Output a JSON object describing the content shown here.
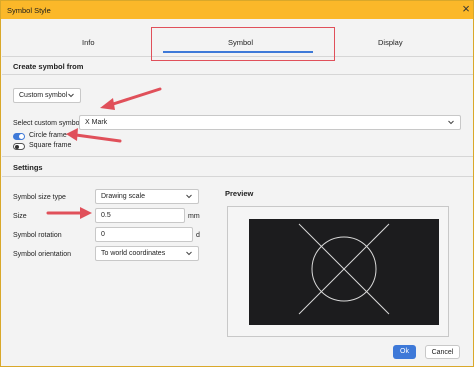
{
  "window": {
    "title": "Symbol Style",
    "close_glyph": "×"
  },
  "tabs": [
    {
      "label": "Info"
    },
    {
      "label": "Symbol"
    },
    {
      "label": "Display"
    }
  ],
  "create_section": {
    "heading": "Create symbol from",
    "source_select": {
      "value": "Custom symbol",
      "icon": "chevron-down-icon"
    },
    "custom_symbol_label": "Select custom symbol",
    "custom_symbol_select": {
      "value": "X Mark",
      "icon": "chevron-down-icon"
    },
    "circle_frame": {
      "label": "Circle frame",
      "state": "on"
    },
    "square_frame": {
      "label": "Square frame",
      "state": "off"
    }
  },
  "settings_section": {
    "heading": "Settings",
    "size_type": {
      "label": "Symbol size type",
      "value": "Drawing scale"
    },
    "size": {
      "label": "Size",
      "value": "0.5",
      "unit": "mm"
    },
    "rotation": {
      "label": "Symbol rotation",
      "value": "0",
      "unit": "d"
    },
    "orientation": {
      "label": "Symbol orientation",
      "value": "To world coordinates"
    }
  },
  "preview": {
    "heading": "Preview",
    "symbol": "x-mark-in-circle"
  },
  "buttons": {
    "ok": "Ok",
    "cancel": "Cancel"
  },
  "colors": {
    "titlebar": "#fbb829",
    "accent": "#3e79d8",
    "annotation": "#e0505a",
    "preview_bg": "#1c1c1e",
    "preview_stroke": "#d8d8d8"
  }
}
